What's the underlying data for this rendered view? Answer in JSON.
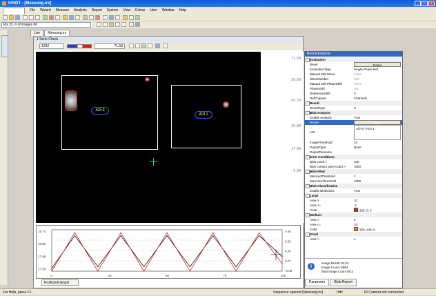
{
  "window": {
    "title": "IVNDT - [Messung.irx]",
    "buttons": {
      "minimize": "_",
      "maximize": "□",
      "close": "x"
    }
  },
  "menu": [
    "File",
    "Wizard",
    "Measure",
    "Analysis",
    "Report",
    "System",
    "View",
    "Extras",
    "User",
    "Window",
    "Help"
  ],
  "image_selector": {
    "value": "Idx 33, # of images 60"
  },
  "tabs": [
    {
      "label": "Live"
    },
    {
      "label": "Messung.irx"
    }
  ],
  "document": {
    "header": "1 Serie Check",
    "xy_value": "1032",
    "temp_value": "71.58",
    "roi_labels": [
      "AOI 0",
      "AOI 1"
    ],
    "ruler_ticks": [
      "71.58",
      "56.68",
      "43.78",
      "30.88",
      "17.98",
      "5.08"
    ]
  },
  "graph": {
    "tab_label": "Profil/Zeit Graph",
    "left_ticks": [
      "19.74",
      "18.86",
      "17.98",
      "17.09"
    ],
    "right_ticks": [
      "0.46",
      "0.33",
      "0.20",
      "0.07",
      "-0.05"
    ],
    "x_ticks": [
      "0",
      "25",
      "50",
      "75",
      "100"
    ]
  },
  "chart_data": {
    "type": "line",
    "x": [
      0,
      10,
      20,
      30,
      40,
      50,
      60,
      70,
      80,
      90,
      100
    ],
    "series": [
      {
        "values": [
          17.2,
          19.4,
          17.3,
          19.4,
          17.3,
          19.4,
          17.3,
          19.4,
          17.3,
          19.4,
          18.0
        ]
      },
      {
        "values": [
          17.0,
          19.6,
          17.0,
          19.6,
          17.0,
          19.6,
          17.0,
          19.6,
          17.0,
          19.6,
          17.5
        ]
      }
    ],
    "ylim": [
      17.0,
      19.8
    ],
    "xlim": [
      0,
      100
    ]
  },
  "explorer": {
    "title": "Result Explorer",
    "rows": [
      {
        "type": "section",
        "key": "Evaluation"
      },
      {
        "key": "Reset",
        "value": "Reset",
        "button": true
      },
      {
        "key": "EvaluationType",
        "value": "Single-Phase Ref."
      },
      {
        "key": "Manual Edit Wave",
        "value": "False",
        "disabled": true
      },
      {
        "key": "WaveNumber",
        "value": "100",
        "disabled": true
      },
      {
        "key": "Manual Edit PhaseShift",
        "value": "False",
        "disabled": true
      },
      {
        "key": "PhaseShift",
        "value": "-25",
        "disabled": true
      },
      {
        "key": "ReferenceShift",
        "value": "0"
      },
      {
        "key": "RefChannel",
        "value": "Channel1"
      },
      {
        "type": "section",
        "key": "Result"
      },
      {
        "key": "ResultType",
        "value": "X"
      },
      {
        "type": "section",
        "key": "Blob Analysis"
      },
      {
        "key": "Enable Analysis",
        "value": "True"
      },
      {
        "key": "Recalc",
        "value": "Calc",
        "button": true,
        "selected": true
      },
      {
        "key": "AOI",
        "value": "AOI 0 / AOI 1",
        "aoi": true
      },
      {
        "key": "ImageThreshold",
        "value": "10"
      },
      {
        "key": "OutputType",
        "value": "None"
      },
      {
        "key": "OutputFilename",
        "value": ""
      },
      {
        "type": "section",
        "key": "Error Conditions"
      },
      {
        "key": "Blob count >",
        "value": "100"
      },
      {
        "key": "Blob contour pixel count >",
        "value": "1000"
      },
      {
        "type": "section",
        "key": "Blob Filter"
      },
      {
        "key": "MinAreaThreshold",
        "value": "1"
      },
      {
        "key": "MaxAreaThreshold",
        "value": "1000"
      },
      {
        "type": "section",
        "key": "Blob Classification"
      },
      {
        "key": "Enable BlobClass",
        "value": "True"
      },
      {
        "type": "section",
        "key": "Large"
      },
      {
        "key": "Area >",
        "value": "10"
      },
      {
        "key": "Area <=",
        "value": "-1"
      },
      {
        "key": "Color",
        "value": "255; 0; 0",
        "color": "#e02020"
      },
      {
        "type": "section",
        "key": "Medium"
      },
      {
        "key": "Area >",
        "value": "5"
      },
      {
        "key": "Area <=",
        "value": "10"
      },
      {
        "key": "Color",
        "value": "255; 128; 0",
        "color": "#ff8000"
      },
      {
        "type": "section",
        "key": "Small"
      },
      {
        "key": "Area >",
        "value": "1"
      }
    ],
    "info_lines": [
      "Image Result 18.33",
      "Image Count 1/584",
      "Blob Image Count 8/13"
    ],
    "tabs": [
      "Parameter",
      "Blob Report"
    ]
  },
  "status": {
    "help": "For Help, press F1",
    "sequence": "Sequence opened (Messung.irx)",
    "fps": "0Hz",
    "camera": "IR Camera not connected"
  },
  "colors": {
    "title_blue": "#0a5fd8",
    "roi_blue": "#3a5bff",
    "blob_red": "#e02020",
    "cross_green": "#3fd03f"
  }
}
